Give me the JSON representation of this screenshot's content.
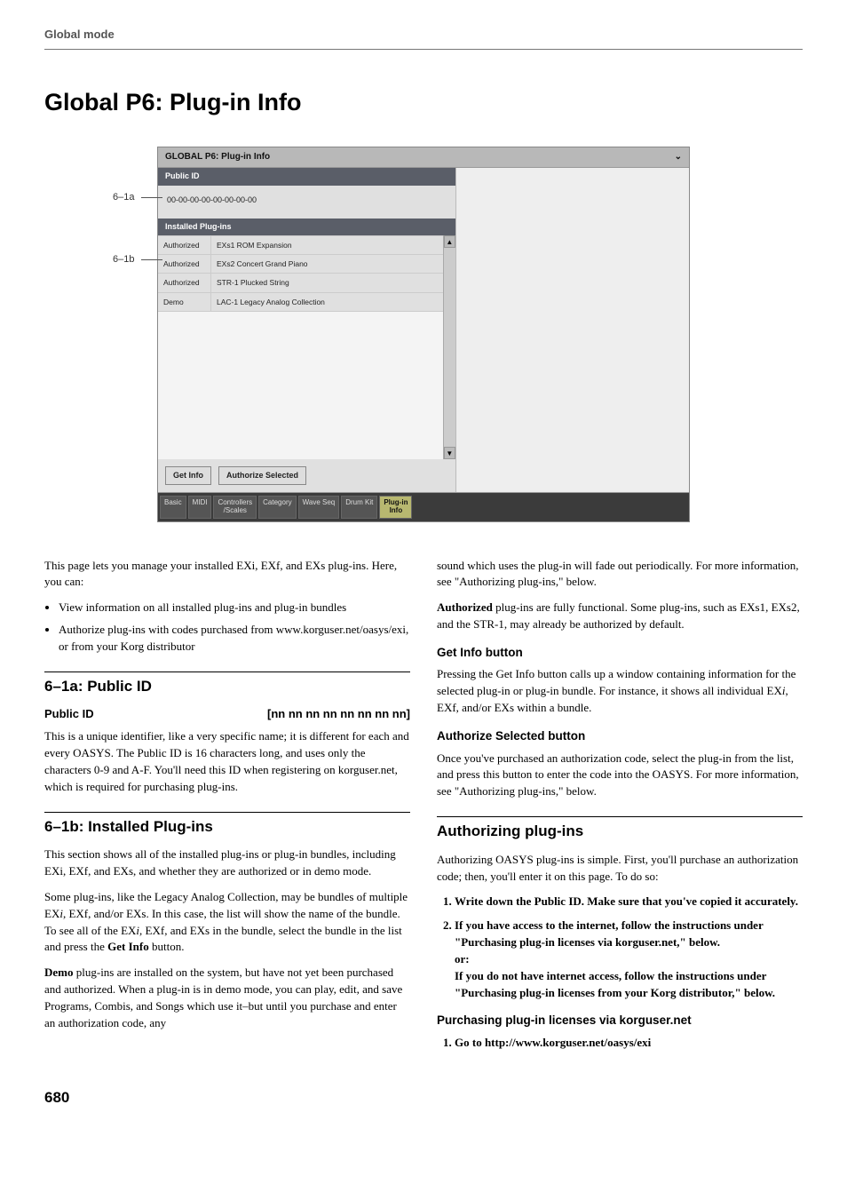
{
  "running_head": "Global mode",
  "page_title": "Global P6: Plug-in Info",
  "page_number": "680",
  "callouts": {
    "a": "6–1a",
    "b": "6–1b"
  },
  "mock": {
    "title": "GLOBAL P6: Plug-in Info",
    "chevron": "⌄",
    "public_id_header": "Public ID",
    "public_id_value": "00-00-00-00-00-00-00-00",
    "installed_header": "Installed Plug-ins",
    "rows": [
      {
        "status": "Authorized",
        "name": "EXs1 ROM Expansion"
      },
      {
        "status": "Authorized",
        "name": "EXs2 Concert Grand Piano"
      },
      {
        "status": "Authorized",
        "name": "STR-1 Plucked String"
      },
      {
        "status": "Demo",
        "name": "LAC-1 Legacy Analog Collection"
      }
    ],
    "btn_get_info": "Get Info",
    "btn_authorize": "Authorize Selected",
    "tabs": [
      "Basic",
      "MIDI",
      "Controllers\n/Scales",
      "Category",
      "Wave Seq",
      "Drum Kit",
      "Plug-in\nInfo"
    ],
    "active_tab": 6
  },
  "left": {
    "intro": "This page lets you manage your installed EXi, EXf, and EXs plug-ins. Here, you can:",
    "bullets": [
      "View information on all installed plug-ins and plug-in bundles",
      "Authorize plug-ins with codes purchased from www.korguser.net/oasys/exi, or from your Korg distributor"
    ],
    "sec_6_1a": "6–1a: Public ID",
    "param_label": "Public ID",
    "param_value": "[nn nn nn nn nn nn nn nn]",
    "pubid_desc": "This is a unique identifier, like a very specific name; it is different for each and every OASYS. The Public ID is 16 characters long, and uses only the characters 0-9 and A-F. You'll need this ID when registering on korguser.net, which is required for purchasing plug-ins.",
    "sec_6_1b": "6–1b: Installed Plug-ins",
    "p_6_1b_1": "This section shows all of the installed plug-ins or plug-in bundles, including EXi, EXf, and EXs, and whether they are authorized or in demo mode.",
    "p_6_1b_2": "Some plug-ins, like the Legacy Analog Collection, may be bundles of multiple EXi, EXf, and/or EXs. In this case, the list will show the name of the bundle. To see all of the EXi, EXf, and EXs in the bundle, select the bundle in the list and press the Get Info button.",
    "p_6_1b_3_pre": "Demo",
    "p_6_1b_3": " plug-ins are installed on the system, but have not yet been purchased and authorized. When a plug-in is in demo mode, you can play, edit, and save Programs, Combis, and Songs which use it–but until you purchase and enter an authorization code, any"
  },
  "right": {
    "p_cont": "sound which uses the plug-in will fade out periodically. For more information, see \"Authorizing plug-ins,\" below.",
    "p_auth_pre": "Authorized",
    "p_auth": " plug-ins are fully functional. Some plug-ins, such as EXs1, EXs2, and the STR-1, may already be authorized by default.",
    "h_get_info": "Get Info button",
    "p_get_info": "Pressing the Get Info button calls up a window containing information for the selected plug-in or plug-in bundle. For instance, it shows all individual EXi, EXf, and/or EXs within a bundle.",
    "h_auth_sel": "Authorize Selected button",
    "p_auth_sel": "Once you've purchased an authorization code, select the plug-in from the list, and press this button to enter the code into the OASYS. For more information, see \"Authorizing plug-ins,\" below.",
    "sec_authorizing": "Authorizing plug-ins",
    "p_authorizing": "Authorizing OASYS plug-ins is simple. First, you'll purchase an authorization code; then, you'll enter it on this page. To do so:",
    "ol1": "Write down the Public ID. Make sure that you've copied it accurately.",
    "ol2a": "If you have access to the internet, follow the instructions under \"Purchasing plug-in licenses via korguser.net,\" below.",
    "ol2_or": "or:",
    "ol2b": "If you do not have internet access, follow the instructions under \"Purchasing plug-in licenses from your Korg distributor,\" below.",
    "h_purchasing": "Purchasing plug-in licenses via korguser.net",
    "ol3": "Go to http://www.korguser.net/oasys/exi"
  }
}
